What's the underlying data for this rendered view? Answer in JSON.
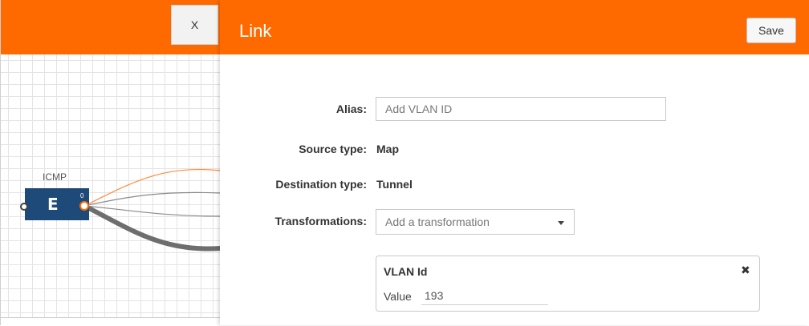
{
  "canvas": {
    "close_label": "X",
    "node": {
      "label": "ICMP",
      "icon": "E",
      "port_count": "0"
    },
    "colors": {
      "node": "#1d4a78",
      "accent": "#ff6a00"
    }
  },
  "panel": {
    "title": "Link",
    "save_label": "Save",
    "alias": {
      "label": "Alias:",
      "placeholder": "Add VLAN ID"
    },
    "source_type": {
      "label": "Source type:",
      "value": "Map"
    },
    "destination_type": {
      "label": "Destination type:",
      "value": "Tunnel"
    },
    "transformations": {
      "label": "Transformations:",
      "placeholder": "Add a transformation"
    },
    "transformation_card": {
      "title": "VLAN Id",
      "close_icon": "close-icon",
      "value_label": "Value",
      "value": "193"
    }
  }
}
